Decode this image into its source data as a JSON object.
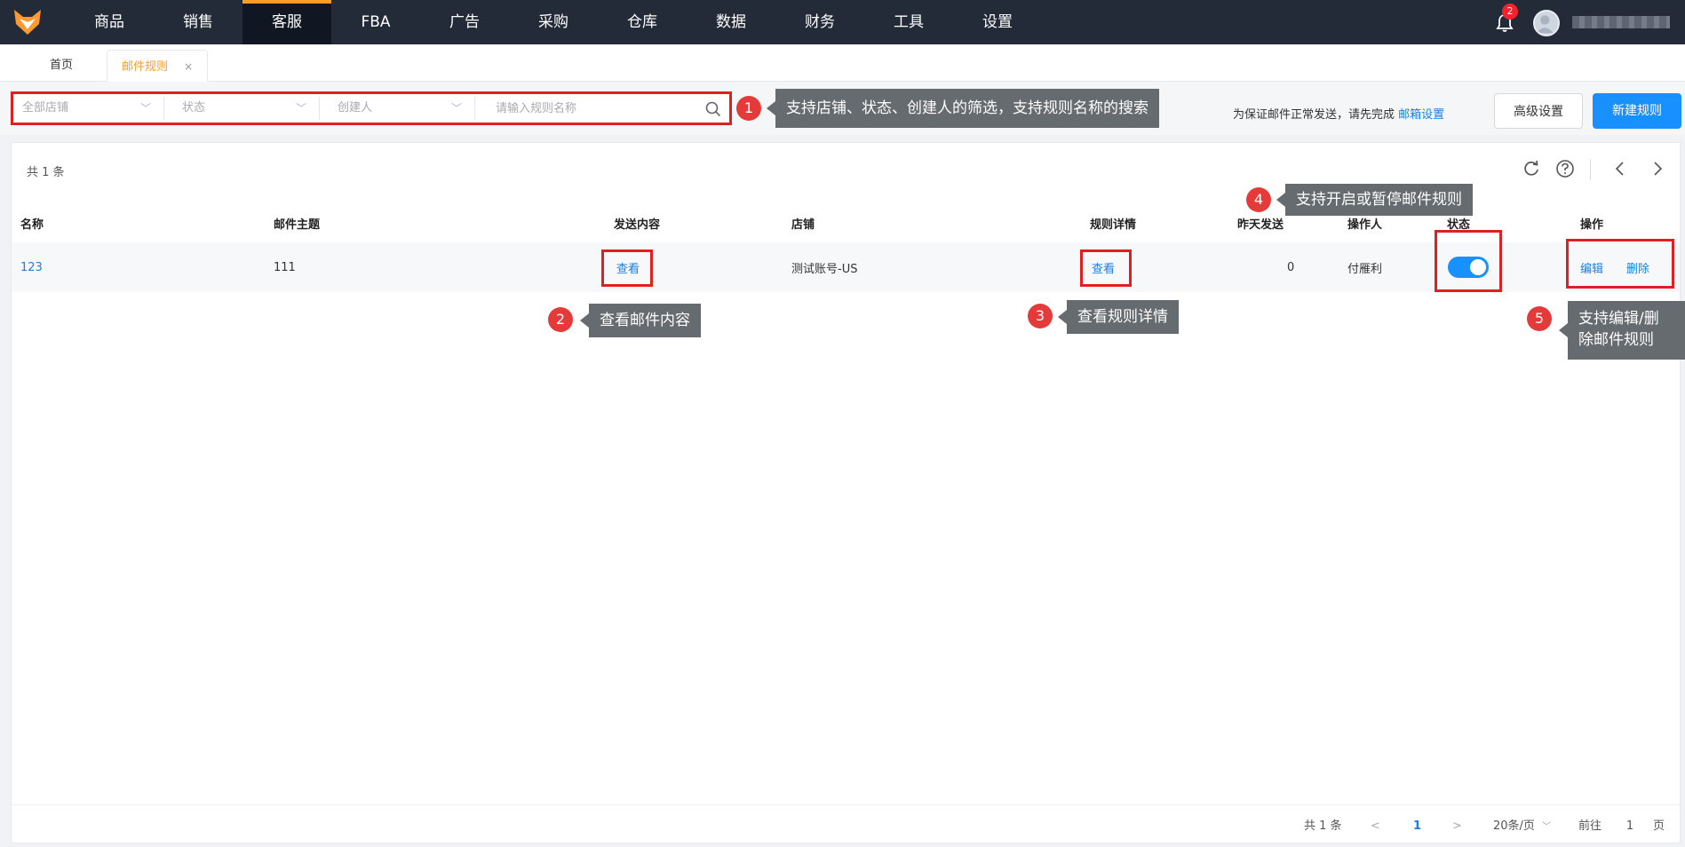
{
  "nav": {
    "items": [
      "商品",
      "销售",
      "客服",
      "FBA",
      "广告",
      "采购",
      "仓库",
      "数据",
      "财务",
      "工具",
      "设置"
    ],
    "active": "客服",
    "notification_count": "2"
  },
  "tabs": {
    "home": "首页",
    "current": "邮件规则",
    "close": "×"
  },
  "filters": {
    "shop": "全部店铺",
    "status": "状态",
    "creator": "创建人",
    "search_placeholder": "请输入规则名称"
  },
  "notice": {
    "text": "为保证邮件正常发送，请先完成",
    "link": "邮箱设置"
  },
  "buttons": {
    "advanced": "高级设置",
    "new_rule": "新建规则"
  },
  "table": {
    "total": "共 1 条",
    "headers": {
      "name": "名称",
      "subject": "邮件主题",
      "content": "发送内容",
      "shop": "店铺",
      "detail": "规则详情",
      "sent_yesterday": "昨天发送",
      "operator": "操作人",
      "status": "状态",
      "actions": "操作"
    },
    "rows": [
      {
        "name": "123",
        "subject": "111",
        "content": "查看",
        "shop": "测试账号-US",
        "detail": "查看",
        "sent_yesterday": "0",
        "operator": "付雁利",
        "status_on": true,
        "edit": "编辑",
        "delete": "删除"
      }
    ]
  },
  "pagination": {
    "total": "共 1 条",
    "prev": "<",
    "page": "1",
    "next": ">",
    "page_size": "20条/页",
    "goto_label": "前往",
    "goto_value": "1",
    "goto_suffix": "页"
  },
  "annotations": {
    "n1": "1",
    "t1": "支持店铺、状态、创建人的筛选，支持规则名称的搜索",
    "n2": "2",
    "t2": "查看邮件内容",
    "n3": "3",
    "t3": "查看规则详情",
    "n4": "4",
    "t4": "支持开启或暂停邮件规则",
    "n5": "5",
    "t5a": "支持编辑/删",
    "t5b": "除邮件规则"
  }
}
